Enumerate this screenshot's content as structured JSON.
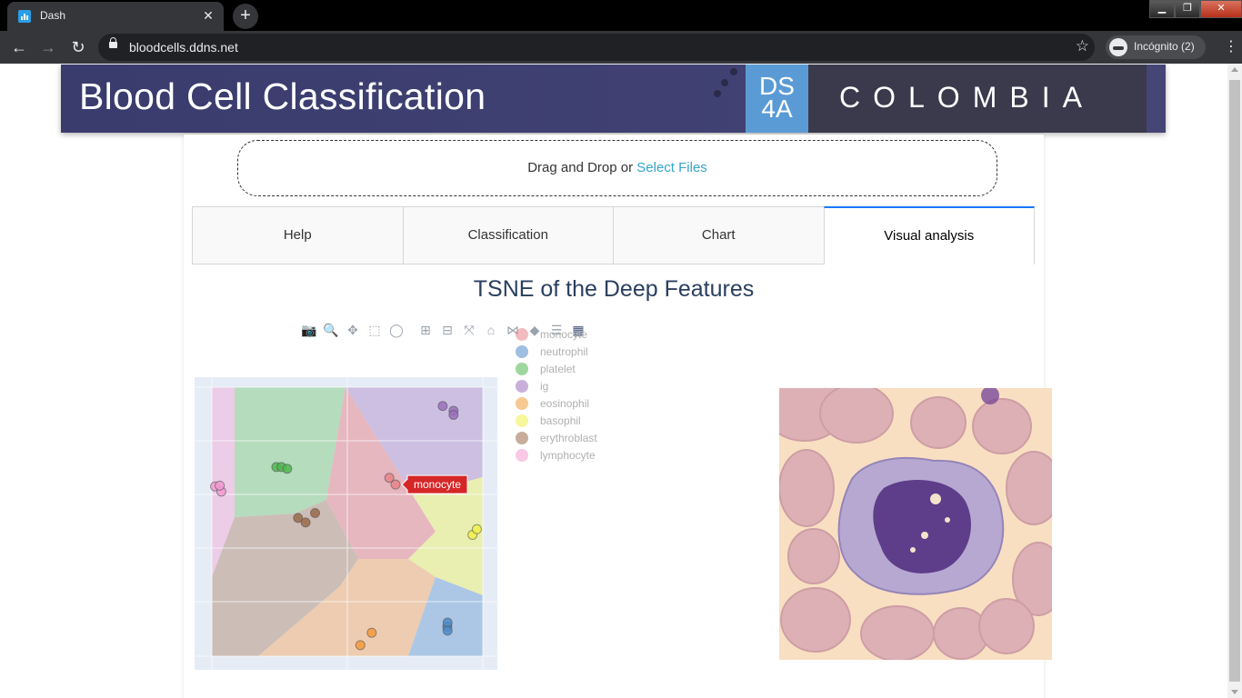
{
  "browser": {
    "tab_title": "Dash",
    "tab_close": "✕",
    "new_tab": "+",
    "url": "bloodcells.ddns.net",
    "profile": "Incógnito (2)",
    "back_icon": "←",
    "forward_icon": "→",
    "reload_icon": "↻",
    "star_icon": "☆",
    "menu_icon": "⋮"
  },
  "banner": {
    "title": "Blood Cell Classification",
    "logo_line1": "DS",
    "logo_line2": "4A",
    "country": "COLOMBIA"
  },
  "upload": {
    "text": "Drag and Drop or ",
    "link": "Select Files"
  },
  "tabs": [
    {
      "label": "Help"
    },
    {
      "label": "Classification"
    },
    {
      "label": "Chart"
    },
    {
      "label": "Visual analysis",
      "active": true
    }
  ],
  "plot": {
    "title": "TSNE of the Deep Features",
    "modebar": [
      "camera-icon",
      "zoom-icon",
      "pan-icon",
      "box-select-icon",
      "lasso-icon",
      "zoom-in-icon",
      "zoom-out-icon",
      "autoscale-icon",
      "reset-axes-icon",
      "spike-lines-icon",
      "hover-closest-icon",
      "hover-compare-icon",
      "plotly-logo-icon"
    ],
    "hover_label": "monocyte",
    "legend": [
      {
        "name": "monocyte",
        "color": "#e8838a"
      },
      {
        "name": "neutrophil",
        "color": "#4f8ac8"
      },
      {
        "name": "platelet",
        "color": "#4fb84f"
      },
      {
        "name": "ig",
        "color": "#9a6fbb"
      },
      {
        "name": "eosinophil",
        "color": "#f39a3a"
      },
      {
        "name": "basophil",
        "color": "#f1f148"
      },
      {
        "name": "erythroblast",
        "color": "#9a6a4a"
      },
      {
        "name": "lymphocyte",
        "color": "#f29ad0"
      }
    ]
  },
  "chart_data": {
    "type": "scatter",
    "title": "TSNE of the Deep Features",
    "xlabel": "",
    "ylabel": "",
    "grid": true,
    "legend_position": "top-right",
    "series": [
      {
        "name": "monocyte",
        "x": [
          0.655,
          0.678
        ],
        "y": [
          0.663,
          0.638
        ]
      },
      {
        "name": "neutrophil",
        "x": [
          0.869,
          0.87,
          0.87
        ],
        "y": [
          0.11,
          0.125,
          0.095
        ]
      },
      {
        "name": "platelet",
        "x": [
          0.238,
          0.257,
          0.278
        ],
        "y": [
          0.703,
          0.703,
          0.697
        ]
      },
      {
        "name": "ig",
        "x": [
          0.852,
          0.892,
          0.892
        ],
        "y": [
          0.93,
          0.912,
          0.897
        ]
      },
      {
        "name": "eosinophil",
        "x": [
          0.548,
          0.59
        ],
        "y": [
          0.041,
          0.087
        ]
      },
      {
        "name": "basophil",
        "x": [
          0.962,
          0.978
        ],
        "y": [
          0.451,
          0.472
        ]
      },
      {
        "name": "erythroblast",
        "x": [
          0.318,
          0.346,
          0.381
        ],
        "y": [
          0.514,
          0.497,
          0.532
        ]
      },
      {
        "name": "lymphocyte",
        "x": [
          0.012,
          0.035,
          0.029
        ],
        "y": [
          0.631,
          0.612,
          0.634
        ]
      }
    ]
  }
}
